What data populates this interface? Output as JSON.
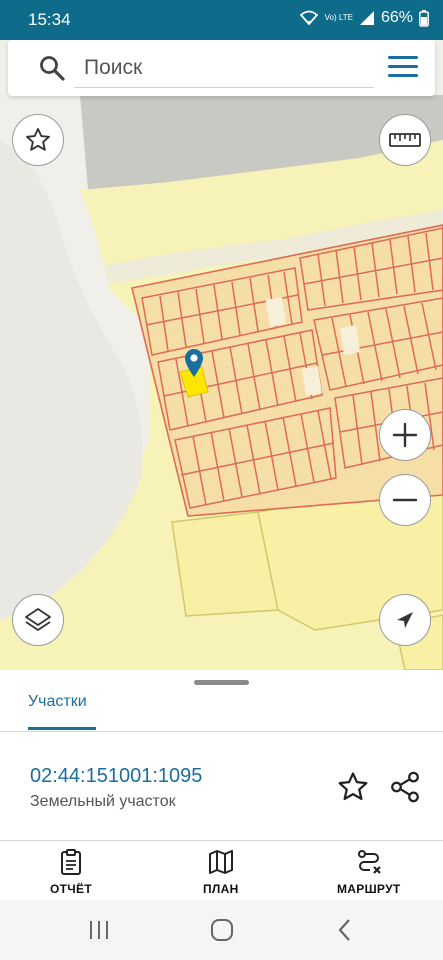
{
  "status_bar": {
    "time": "15:34",
    "network_label": "Vo) LTE",
    "battery": "66%"
  },
  "search": {
    "placeholder": "Поиск"
  },
  "bottom_sheet": {
    "tab_label": "Участки",
    "cadastral_number": "02:44:151001:1095",
    "parcel_type": "Земельный участок"
  },
  "actions": {
    "report_label": "ОТЧЁТ",
    "plan_label": "ПЛАН",
    "route_label": "МАРШРУТ"
  },
  "colors": {
    "status_bar": "#0f6b8a",
    "accent": "#1a6ea0",
    "parcel_fill": "#f3e88f",
    "parcel_border": "#e06a55",
    "selected_parcel": "#ffe600"
  },
  "icons": [
    "search-icon",
    "menu-icon",
    "star-icon",
    "ruler-icon",
    "layers-icon",
    "zoom-in-icon",
    "zoom-out-icon",
    "location-arrow-icon",
    "map-pin-icon",
    "share-icon",
    "clipboard-icon",
    "map-icon",
    "route-icon"
  ]
}
